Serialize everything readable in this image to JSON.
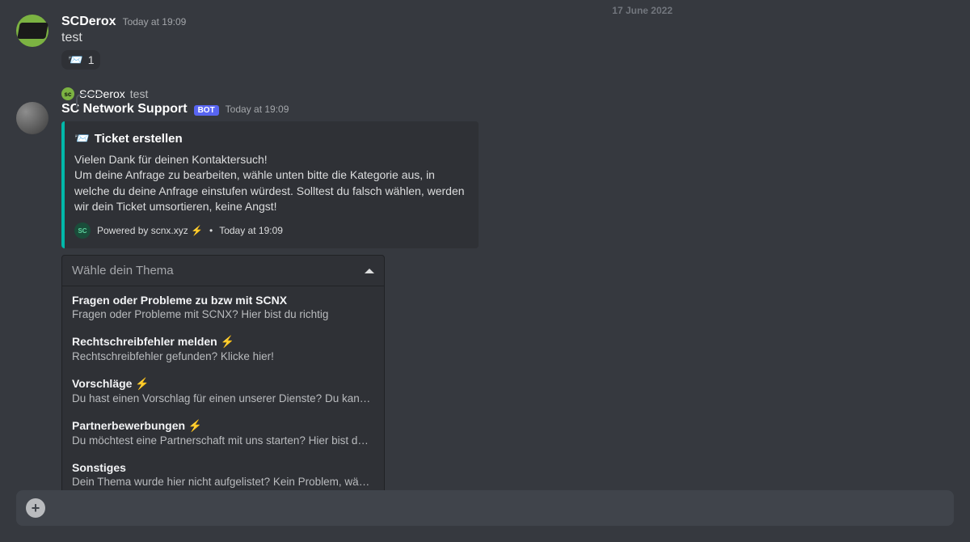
{
  "top_date": "17 June 2022",
  "msg1": {
    "username": "SCDerox",
    "avatar_text": "sc",
    "timestamp": "Today at 19:09",
    "content": "test",
    "reaction_emoji": "📨",
    "reaction_count": "1"
  },
  "reply": {
    "avatar_text": "sc",
    "name": "SCDerox",
    "content": "test"
  },
  "msg2": {
    "username": "SC Network Support",
    "bot_tag": "BOT",
    "timestamp": "Today at 19:09"
  },
  "embed": {
    "title_emoji": "📨",
    "title": "Ticket erstellen",
    "desc_line1": "Vielen Dank für deinen Kontaktersuch!",
    "desc_line2": "Um deine Anfrage zu bearbeiten, wähle unten bitte die Kategorie aus, in welche du deine Anfrage einstufen würdest. Solltest du falsch wählen, werden wir dein Ticket umsortieren, keine Angst!",
    "footer_icon_text": "SC",
    "footer_text": "Powered by scnx.xyz ⚡",
    "footer_sep": "•",
    "footer_time": "Today at 19:09"
  },
  "select": {
    "placeholder": "Wähle dein Thema",
    "options": [
      {
        "label": "Fragen oder Probleme zu bzw mit SCNX",
        "desc": "Fragen oder Probleme mit SCNX? Hier bist du richtig"
      },
      {
        "label": "Rechtschreibfehler melden ⚡",
        "desc": "Rechtschreibfehler gefunden? Klicke hier!"
      },
      {
        "label": "Vorschläge ⚡",
        "desc": "Du hast einen Vorschlag für einen unserer Dienste? Du kannst i…"
      },
      {
        "label": "Partnerbewerbungen ⚡",
        "desc": "Du möchtest eine Partnerschaft mit uns starten? Hier bist du ri…"
      },
      {
        "label": "Sonstiges",
        "desc": "Dein Thema wurde hier nicht aufgelistet? Kein Problem, wähle …"
      }
    ]
  }
}
